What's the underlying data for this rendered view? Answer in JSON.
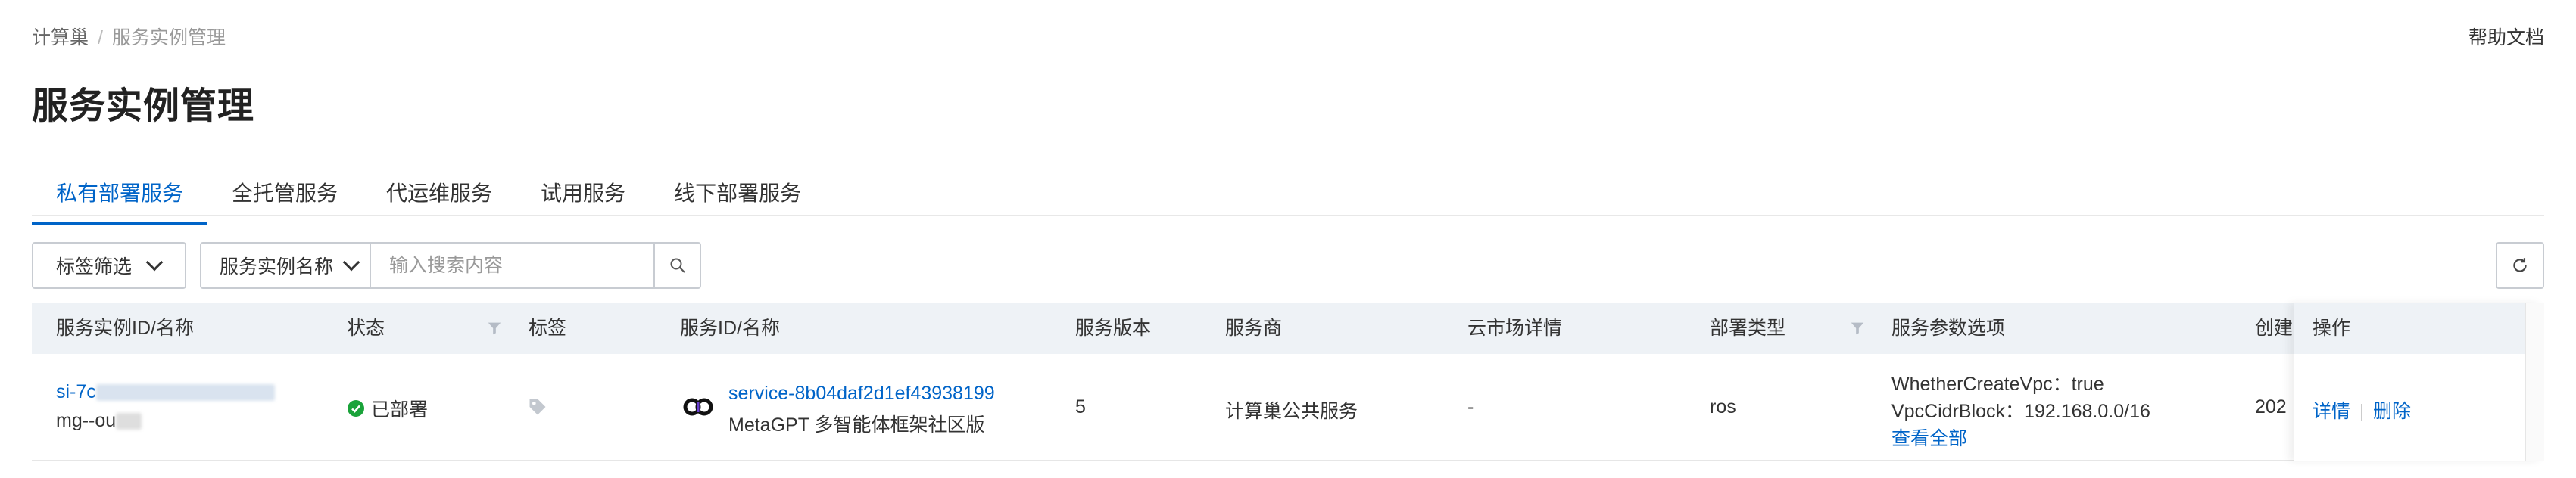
{
  "breadcrumb": {
    "root": "计算巢",
    "separator": "/",
    "current": "服务实例管理"
  },
  "help_link": "帮助文档",
  "page_title": "服务实例管理",
  "tabs": [
    {
      "label": "私有部署服务",
      "active": true
    },
    {
      "label": "全托管服务",
      "active": false
    },
    {
      "label": "代运维服务",
      "active": false
    },
    {
      "label": "试用服务",
      "active": false
    },
    {
      "label": "线下部署服务",
      "active": false
    }
  ],
  "filters": {
    "tag_filter": "标签筛选",
    "search_field": "服务实例名称",
    "search_placeholder": "输入搜索内容"
  },
  "table": {
    "columns": {
      "instance": "服务实例ID/名称",
      "status": "状态",
      "tags": "标签",
      "service": "服务ID/名称",
      "version": "服务版本",
      "provider": "服务商",
      "market": "云市场详情",
      "deploy_type": "部署类型",
      "params": "服务参数选项",
      "created": "创建",
      "actions": "操作"
    },
    "rows": [
      {
        "instance_id_prefix": "si-7c",
        "instance_name_prefix": "mg--ou",
        "status": "已部署",
        "service_id": "service-8b04daf2d1ef43938199",
        "service_name": "MetaGPT 多智能体框架社区版",
        "version": "5",
        "provider": "计算巢公共服务",
        "market": "-",
        "deploy_type": "ros",
        "params": [
          "WhetherCreateVpc：true",
          "VpcCidrBlock：192.168.0.0/16"
        ],
        "params_more": "查看全部",
        "created_prefix": "202",
        "action_detail": "详情",
        "action_delete": "删除"
      }
    ]
  },
  "colors": {
    "primary": "#0064c8",
    "success": "#1aa33a",
    "header_bg": "#eef2f6"
  },
  "icons": [
    "chevron-down-icon",
    "search-icon",
    "refresh-icon",
    "filter-icon",
    "tag-icon",
    "status-success-icon",
    "metagpt-logo-icon"
  ]
}
